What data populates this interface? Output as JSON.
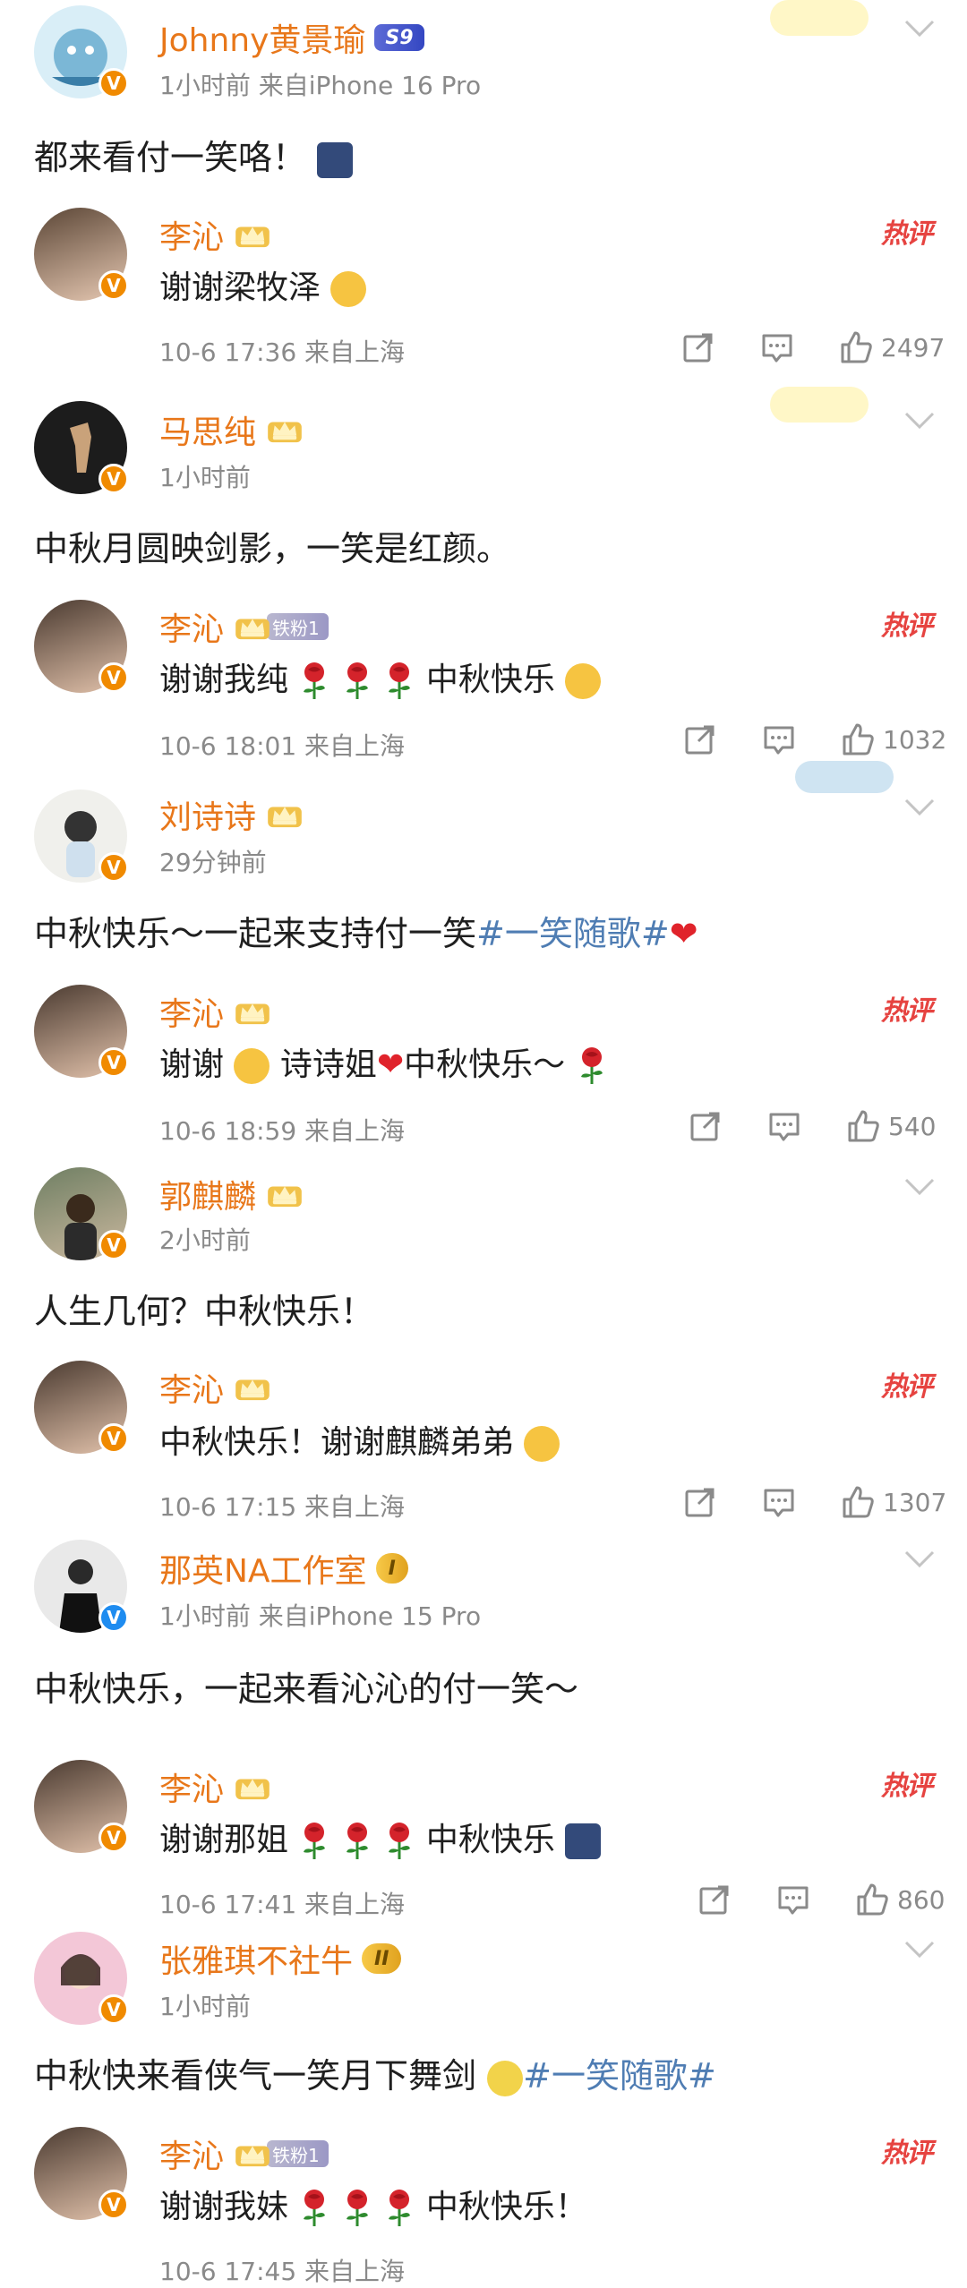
{
  "colors": {
    "name": "#e8771a",
    "meta": "#8a8a8a",
    "hot": "#e64340",
    "topic": "#4f7db3"
  },
  "post1": {
    "name": "Johnny黄景瑜",
    "badge": "S9",
    "meta": "1小时前  来自iPhone 16 Pro",
    "text": "都来看付一笑咯！",
    "reply": {
      "name": "李沁",
      "text": "谢谢梁牧泽",
      "meta": "10-6 17:36  来自上海",
      "hot": "热评",
      "likes": "2497"
    }
  },
  "post2": {
    "name": "马思纯",
    "meta": "1小时前",
    "text": "中秋月圆映剑影，一笑是红颜。",
    "reply": {
      "name": "李沁",
      "fan": "铁粉1",
      "text_a": "谢谢我纯",
      "text_b": "中秋快乐",
      "meta": "10-6 18:01  来自上海",
      "hot": "热评",
      "likes": "1032"
    }
  },
  "post3": {
    "name": "刘诗诗",
    "meta": "29分钟前",
    "text": "中秋快乐～一起来支持付一笑",
    "topic": "#一笑随歌#",
    "reply": {
      "name": "李沁",
      "text_a": "谢谢",
      "text_b": "诗诗姐",
      "text_c": "中秋快乐～",
      "meta": "10-6 18:59  来自上海",
      "hot": "热评",
      "likes": "540"
    }
  },
  "post4": {
    "name": "郭麒麟",
    "meta": "2小时前",
    "text": "人生几何？中秋快乐！",
    "reply": {
      "name": "李沁",
      "text": "中秋快乐！谢谢麒麟弟弟",
      "meta": "10-6 17:15  来自上海",
      "hot": "热评",
      "likes": "1307"
    }
  },
  "post5": {
    "name": "那英NA工作室",
    "level": "I",
    "meta": "1小时前  来自iPhone 15 Pro",
    "text": "中秋快乐，一起来看沁沁的付一笑～",
    "reply": {
      "name": "李沁",
      "text_a": "谢谢那姐",
      "text_b": "中秋快乐",
      "meta": "10-6 17:41  来自上海",
      "hot": "热评",
      "likes": "860"
    }
  },
  "post6": {
    "name": "张雅琪不社牛",
    "level": "II",
    "meta": "1小时前",
    "text": "中秋快来看侠气一笑月下舞剑",
    "topic": "#一笑随歌#",
    "reply": {
      "name": "李沁",
      "fan": "铁粉1",
      "text_a": "谢谢我妹",
      "text_b": "中秋快乐！",
      "meta": "10-6 17:45  来自上海",
      "hot": "热评"
    }
  },
  "icons": [
    "share-icon",
    "comment-icon",
    "like-icon",
    "chevron-down-icon",
    "crown-icon",
    "rose-icon",
    "heart-icon",
    "verified-icon"
  ]
}
